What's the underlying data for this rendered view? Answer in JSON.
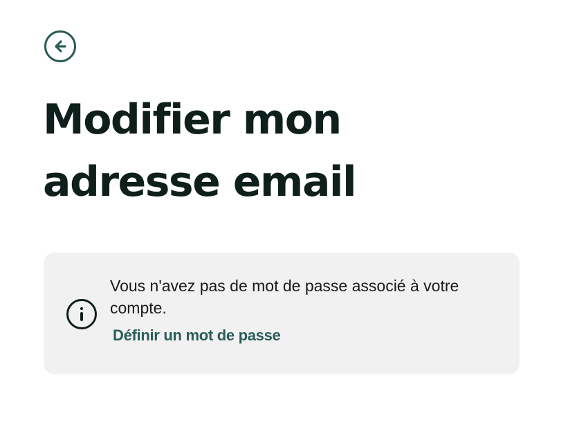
{
  "header": {
    "back_icon": "arrow-left-circle-icon"
  },
  "page": {
    "title": "Modifier mon adresse email"
  },
  "info_card": {
    "icon": "info-circle-icon",
    "message": "Vous n'avez pas de mot de passe associé à votre compte.",
    "link_label": "Définir un mot de passe"
  },
  "colors": {
    "accent": "#2a5c57",
    "text": "#0f1f1c",
    "card_background": "#f1f1f1",
    "background": "#ffffff"
  }
}
